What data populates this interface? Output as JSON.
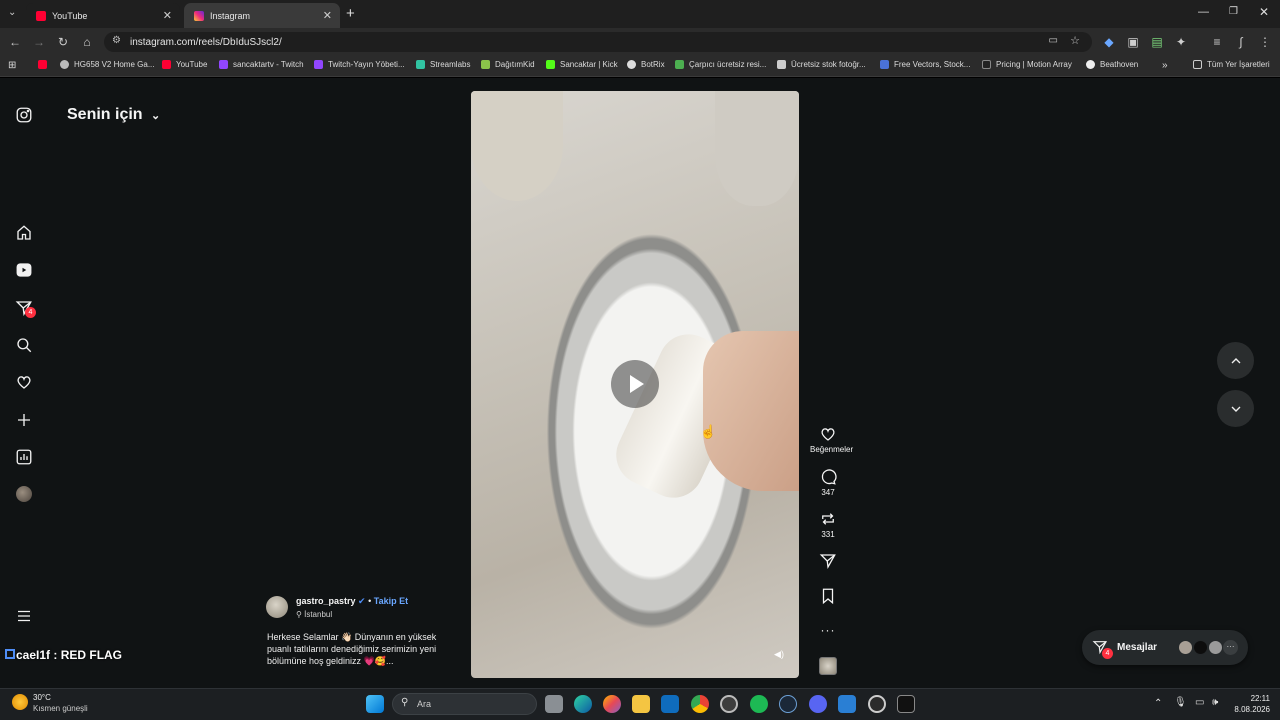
{
  "browser": {
    "tabs": [
      {
        "title": "YouTube",
        "active": false
      },
      {
        "title": "Instagram",
        "active": true
      }
    ],
    "url": "instagram.com/reels/DbIduSJscl2/",
    "bookmarks": [
      "HG658 V2 Home Ga...",
      "YouTube",
      "sancaktartv - Twitch",
      "Twitch-Yayın Yöbeti...",
      "Streamlabs",
      "DağıtımKid",
      "Sancaktar | Kick",
      "BotRix",
      "Çarpıcı ücretsiz resi...",
      "Ücretsiz stok fotoğr...",
      "Free Vectors, Stock...",
      "Pricing | Motion Array",
      "Beathoven"
    ],
    "bookmarks_overflow": "»",
    "all_bookmarks": "Tüm Yer İşaretleri"
  },
  "instagram": {
    "feed_title": "Senin için",
    "notification_count": "4",
    "actions": {
      "likes_label": "Beğenmeler",
      "comments_count": "347",
      "reposts_count": "331"
    },
    "post": {
      "username": "gastro_pastry",
      "follow_label": "Takip Et",
      "location": "İstanbul",
      "caption_line1": "Herkese Selamlar 👋🏻 Dünyanın en yüksek",
      "caption_line2": "puanlı tatlılarını denediğimiz serimizin yeni",
      "caption_line3": "bölümüne hoş geldinizz 💗🥰..."
    },
    "messages": {
      "label": "Mesajlar",
      "badge": "4"
    },
    "overlay_text": "caeI1f : RED FLAG"
  },
  "taskbar": {
    "weather_temp": "30°C",
    "weather_desc": "Kısmen güneşli",
    "search_placeholder": "Ara",
    "time": "22:11",
    "date": "8.08.2026"
  },
  "colors": {
    "accent_blue": "#4f8ef7",
    "badge_red": "#ff3040",
    "youtube_red": "#ff0033"
  }
}
